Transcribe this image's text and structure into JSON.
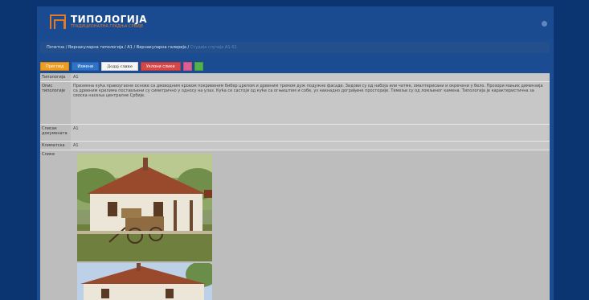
{
  "header": {
    "title": "ТИПОЛОГИЈА",
    "subtitle": "ТРАДИЦИОНАЛНА ГРАДЊА СРБИЈЕ"
  },
  "breadcrumb": {
    "items": [
      "Почетна",
      "Вернакуларна типологија",
      "А1",
      "Вернакуларна галерија"
    ],
    "current": "Студија случаја А1-01"
  },
  "toolbar": {
    "buttons": [
      "Преглед",
      "Измени",
      "Додај слике",
      "Уклони слике"
    ]
  },
  "rows": {
    "typology_label": "Типологија",
    "typology_value": "А1",
    "description_label": "Опис типологије",
    "description_value": "Приземна кућа правоугаоне основе са двоводним кровом покривеним бибер црепом и дрвеним тремом дуж подужне фасаде. Зидови су од набоја или чатме, омалтерисани и окречени у бело. Прозори мањих димензија са дрвеним крилима постављени су симетрично у односу на улаз. Кућа се састоји од куће са огњиштем и собе, уз накнадно дограђене просторије. Темељи су од ломљеног камена. Типологија је карактеристична за сеоска насеља централне Србије.",
    "documents_label": "Списак докумената",
    "documents_value": "А1",
    "climate_label": "Климатска",
    "climate_value": "А1",
    "images_label": "Слике"
  },
  "colors": {
    "accent": "#ef9c22",
    "primary": "#1b4c92",
    "danger": "#d64848",
    "success": "#52b24c"
  }
}
